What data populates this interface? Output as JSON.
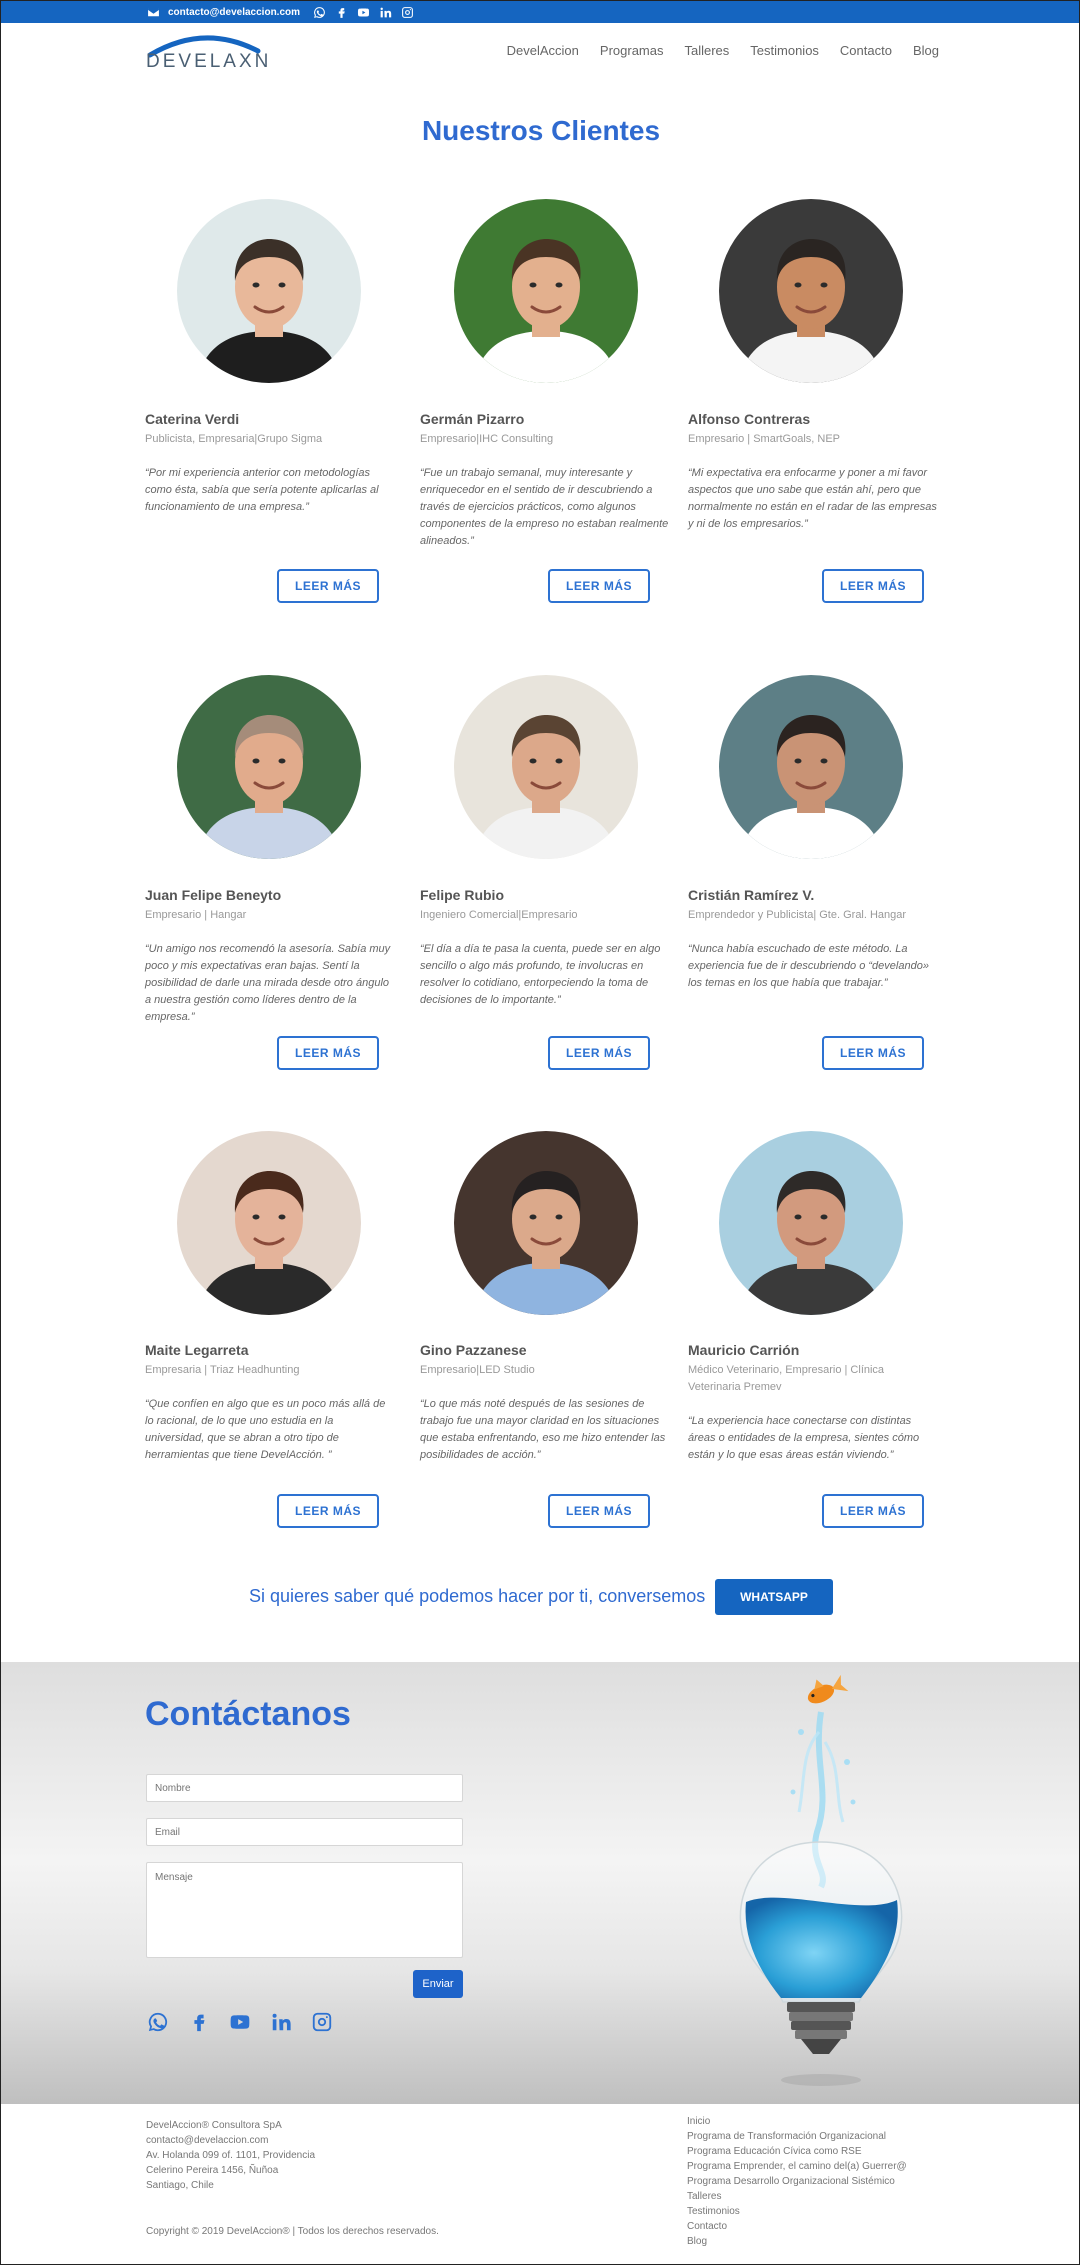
{
  "topbar": {
    "email": "contacto@develaccion.com",
    "icons": [
      "mail-icon",
      "whatsapp-icon",
      "facebook-icon",
      "youtube-icon",
      "linkedin-icon",
      "instagram-icon"
    ],
    "bg_color": "#1565c0"
  },
  "header": {
    "logo_text": "DEVELAXN",
    "nav": [
      "DevelAccion",
      "Programas",
      "Talleres",
      "Testimonios",
      "Contacto",
      "Blog"
    ]
  },
  "section_title": "Nuestros Clientes",
  "button_label": "LEER MÁS",
  "clients": [
    {
      "name": "Caterina Verdi",
      "role": "Publicista, Empresaria|Grupo Sigma",
      "quote": "“Por mi experiencia anterior con metodologías como ésta, sabía que sería potente aplicarlas al funcionamiento de una empresa.”"
    },
    {
      "name": "Germán Pizarro",
      "role": "Empresario|IHC Consulting",
      "quote": "“Fue un trabajo semanal, muy interesante y enriquecedor en el sentido de ir descubriendo a través de ejercicios prácticos, como algunos componentes de la empreso no estaban realmente alineados.”"
    },
    {
      "name": "Alfonso Contreras",
      "role": "Empresario | SmartGoals, NEP",
      "quote": "“Mi expectativa era enfocarme y poner a mi favor aspectos que uno sabe que están ahí, pero que normalmente no están en el radar de las empresas y ni de los empresarios.”"
    },
    {
      "name": "Juan Felipe Beneyto",
      "role": "Empresario | Hangar",
      "quote": "“Un amigo nos recomendó la asesoría. Sabía muy poco y mis expectativas eran bajas. Sentí la posibilidad de darle una mirada desde otro ángulo a nuestra gestión como líderes dentro de la empresa.”"
    },
    {
      "name": "Felipe Rubio",
      "role": "Ingeniero Comercial|Empresario",
      "quote": "“El día a día te pasa la cuenta, puede ser en algo sencillo o algo más profundo, te involucras en resolver lo cotidiano, entorpeciendo la toma de decisiones de lo importante.”"
    },
    {
      "name": "Cristián Ramírez V.",
      "role": "Emprendedor y Publicista| Gte. Gral. Hangar",
      "quote": "“Nunca había escuchado de este método. La experiencia fue de ir descubriendo o “develando» los temas en los que había que trabajar.”"
    },
    {
      "name": "Maite Legarreta",
      "role": "Empresaria | Triaz Headhunting",
      "quote": "“Que confíen en algo que es un poco más allá de lo racional, de lo que uno estudia en la universidad, que se abran a otro tipo de herramientas que tiene DevelAcción. ”"
    },
    {
      "name": "Gino Pazzanese",
      "role": "Empresario|LED Studio",
      "quote": "“Lo que más noté después de las sesiones de trabajo fue una mayor claridad en los situaciones que estaba enfrentando, eso me hizo entender las posibilidades de acción.”"
    },
    {
      "name": "Mauricio Carrión",
      "role": "Médico Veterinario, Empresario | Clínica Veterinaria Premev",
      "quote": "“La experiencia hace conectarse con distintas áreas o entidades de la empresa, sientes cómo están y lo que esas áreas están viviendo.”"
    }
  ],
  "cta": {
    "text": "Si quieres saber qué podemos hacer por ti, conversemos",
    "button": "WHATSAPP"
  },
  "contact": {
    "title": "Contáctanos",
    "name_placeholder": "Nombre",
    "email_placeholder": "Email",
    "message_placeholder": "Mensaje",
    "send": "Enviar",
    "social_icons": [
      "whatsapp-icon",
      "facebook-icon",
      "youtube-icon",
      "linkedin-icon",
      "instagram-icon"
    ]
  },
  "footer": {
    "address": [
      "DevelAccion® Consultora SpA",
      "contacto@develaccion.com",
      "Av. Holanda 099 of. 1101, Providencia",
      "Celerino Pereira 1456, Ñuñoa",
      "Santiago, Chile"
    ],
    "links": [
      "Inicio",
      "Programa de Transformación Organizacional",
      "Programa Educación Cívica como RSE",
      "Programa Emprender, el camino del(a) Guerrer@",
      "Programa Desarrollo Organizacional Sistémico",
      "Talleres",
      "Testimonios",
      "Contacto",
      "Blog"
    ],
    "copyright": "Copyright © 2019 DevelAccion® | Todos los derechos reservados."
  },
  "colors": {
    "accent": "#2f6ad0",
    "brand_blue": "#1565c0"
  }
}
